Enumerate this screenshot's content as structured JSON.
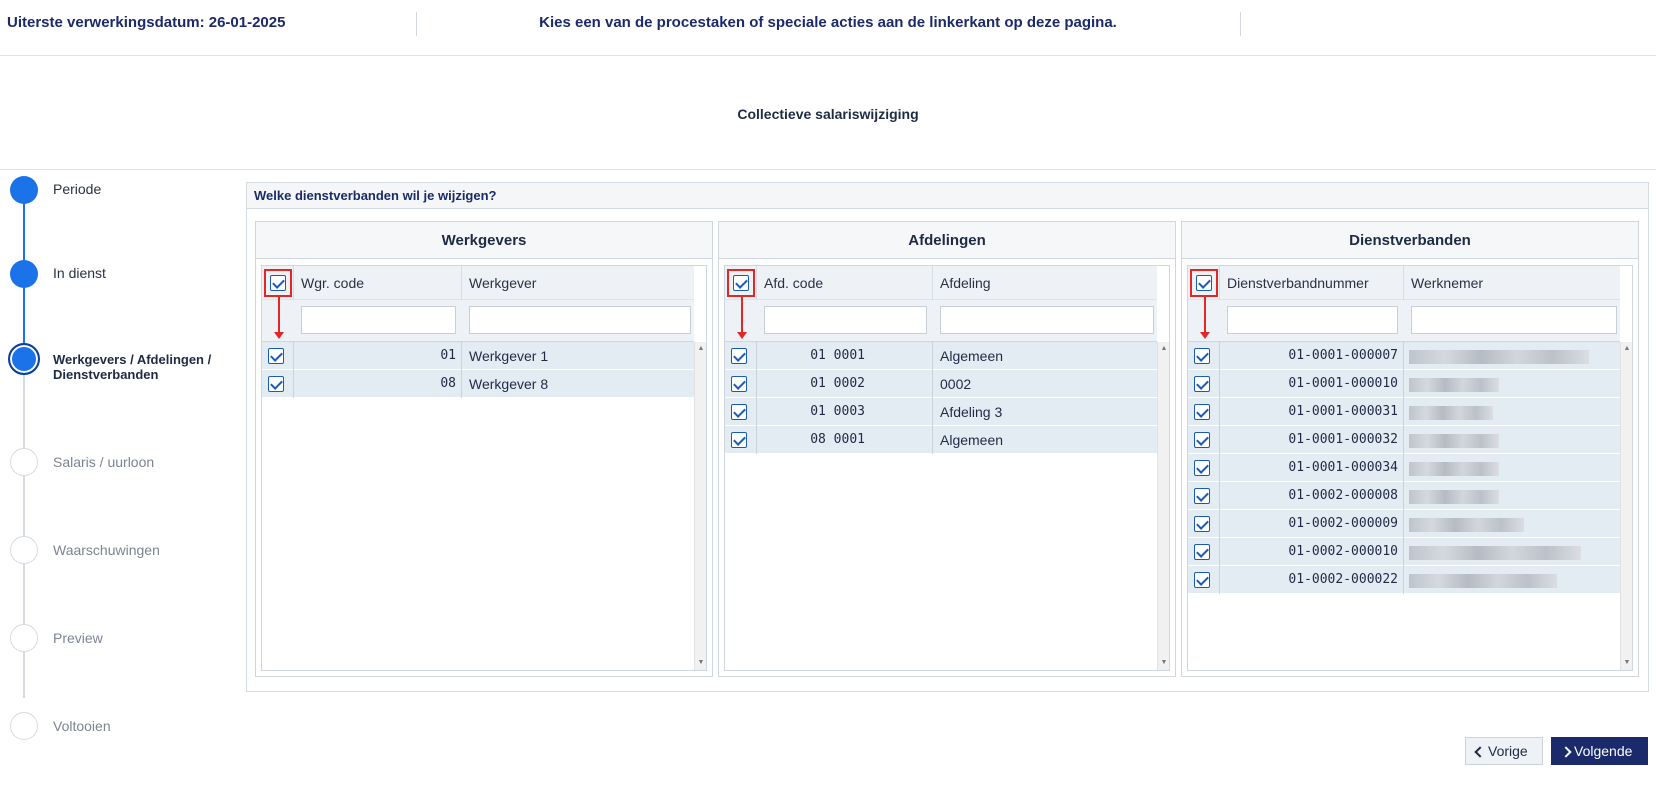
{
  "topbar": {
    "deadline": "Uiterste verwerkingsdatum: 26-01-2025",
    "message": "Kies een van de procestaken of speciale acties aan de linkerkant op deze pagina."
  },
  "page_title": "Collectieve salariswijziging",
  "stepper": {
    "steps": [
      {
        "label": "Periode",
        "state": "done"
      },
      {
        "label": "In dienst",
        "state": "done"
      },
      {
        "label": "Werkgevers / Afdelingen / Dienstverbanden",
        "state": "current"
      },
      {
        "label": "Salaris / uurloon",
        "state": "todo"
      },
      {
        "label": "Waarschuwingen",
        "state": "todo"
      },
      {
        "label": "Preview",
        "state": "todo"
      },
      {
        "label": "Voltooien",
        "state": "todo"
      }
    ]
  },
  "panel": {
    "heading": "Welke dienstverbanden wil je wijzigen?"
  },
  "werkgevers": {
    "title": "Werkgevers",
    "col_code": "Wgr. code",
    "col_name": "Werkgever",
    "rows": [
      {
        "code": "01",
        "name": "Werkgever 1"
      },
      {
        "code": "08",
        "name": "Werkgever 8"
      }
    ]
  },
  "afdelingen": {
    "title": "Afdelingen",
    "col_code": "Afd. code",
    "col_name": "Afdeling",
    "rows": [
      {
        "code": "01 0001",
        "name": "Algemeen"
      },
      {
        "code": "01 0002",
        "name": "0002"
      },
      {
        "code": "01 0003",
        "name": "Afdeling 3"
      },
      {
        "code": "08 0001",
        "name": "Algemeen"
      }
    ]
  },
  "dienstverbanden": {
    "title": "Dienstverbanden",
    "col_code": "Dienstverbandnummer",
    "col_name": "Werknemer",
    "rows": [
      {
        "code": "01-0001-000007"
      },
      {
        "code": "01-0001-000010"
      },
      {
        "code": "01-0001-000031"
      },
      {
        "code": "01-0001-000032"
      },
      {
        "code": "01-0001-000034"
      },
      {
        "code": "01-0002-000008"
      },
      {
        "code": "01-0002-000009"
      },
      {
        "code": "01-0002-000010"
      },
      {
        "code": "01-0002-000022"
      }
    ]
  },
  "buttons": {
    "prev": "Vorige",
    "next": "Volgende"
  },
  "colors": {
    "brand": "#1b2a6b",
    "step_active": "#1a73e8",
    "highlight": "#e32626",
    "row_selected": "#e3ecf3"
  }
}
